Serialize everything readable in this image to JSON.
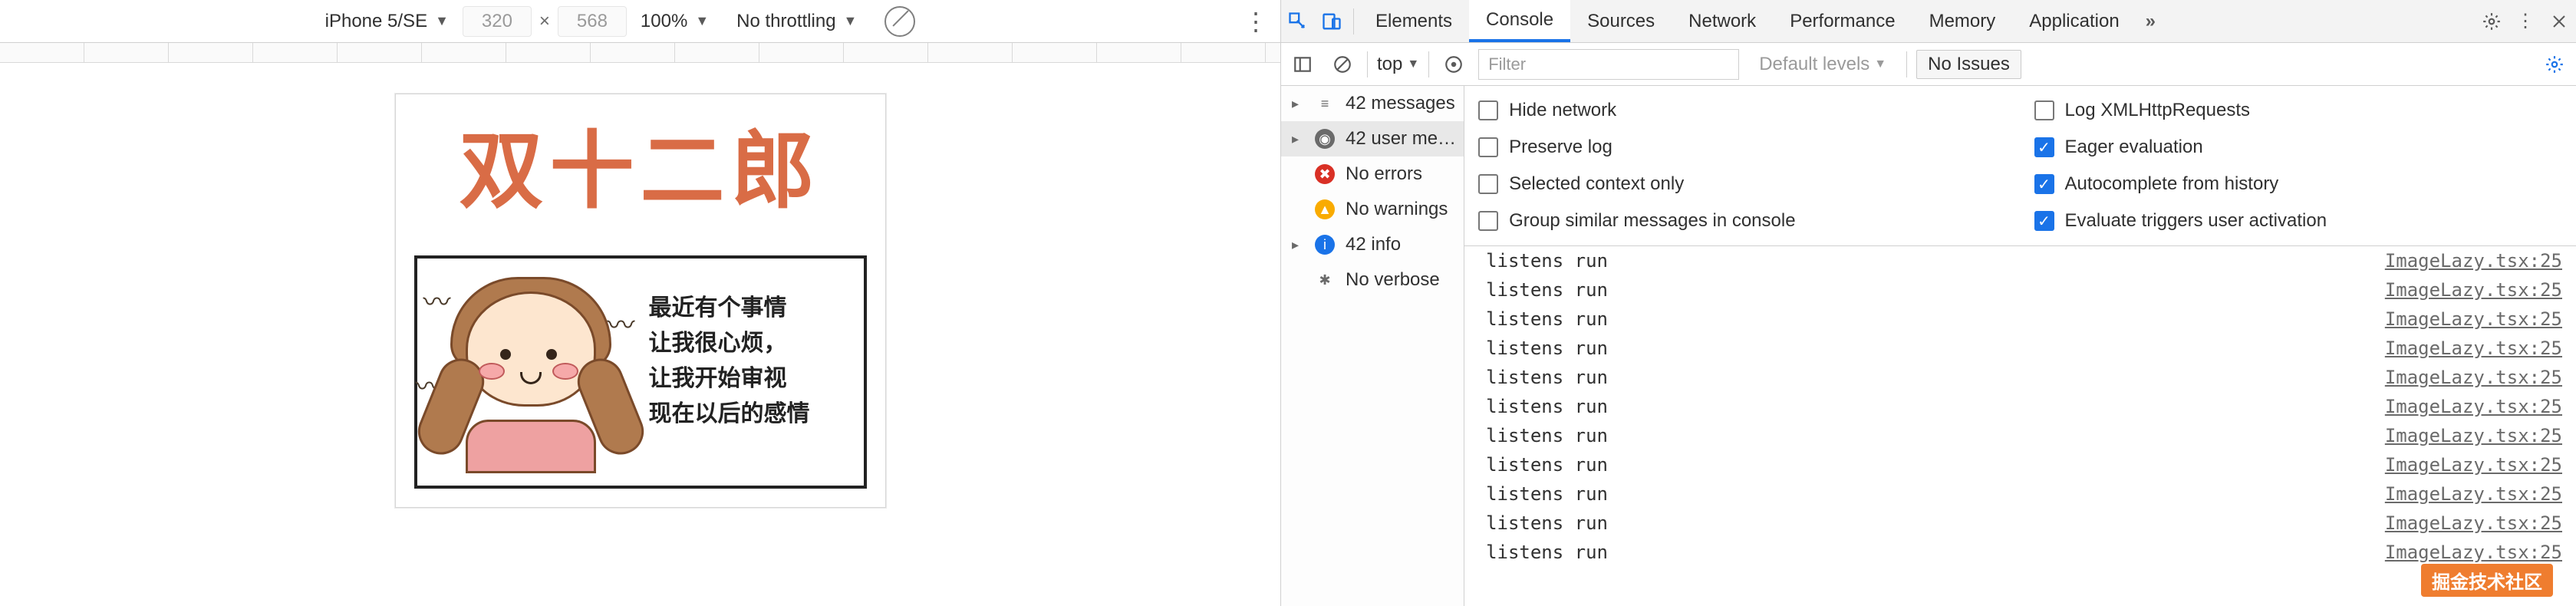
{
  "device_toolbar": {
    "device": "iPhone 5/SE",
    "width": "320",
    "height": "568",
    "zoom": "100%",
    "throttling": "No throttling"
  },
  "phone_content": {
    "headline": "双十二郎",
    "panel_lines": [
      "最近有个事情",
      "让我很心烦，",
      "让我开始审视",
      "现在以后的感情"
    ]
  },
  "devtools": {
    "tabs": [
      "Elements",
      "Console",
      "Sources",
      "Network",
      "Performance",
      "Memory",
      "Application"
    ],
    "active_tab": "Console",
    "more": "»"
  },
  "filterbar": {
    "context": "top",
    "filter_placeholder": "Filter",
    "levels": "Default levels",
    "issues": "No Issues"
  },
  "sidebar": [
    {
      "caret": true,
      "icon": "msg",
      "label": "42 messages"
    },
    {
      "caret": true,
      "icon": "user",
      "label": "42 user me…",
      "selected": true
    },
    {
      "caret": false,
      "icon": "err",
      "label": "No errors"
    },
    {
      "caret": false,
      "icon": "warn",
      "label": "No warnings"
    },
    {
      "caret": true,
      "icon": "info",
      "label": "42 info"
    },
    {
      "caret": false,
      "icon": "verb",
      "label": "No verbose"
    }
  ],
  "settings": {
    "left": [
      {
        "label": "Hide network",
        "checked": false
      },
      {
        "label": "Preserve log",
        "checked": false
      },
      {
        "label": "Selected context only",
        "checked": false
      },
      {
        "label": "Group similar messages in console",
        "checked": false
      }
    ],
    "right": [
      {
        "label": "Log XMLHttpRequests",
        "checked": false
      },
      {
        "label": "Eager evaluation",
        "checked": true
      },
      {
        "label": "Autocomplete from history",
        "checked": true
      },
      {
        "label": "Evaluate triggers user activation",
        "checked": true
      }
    ]
  },
  "log_message": "listens run",
  "log_source": "ImageLazy.tsx:25",
  "log_count": 11,
  "watermark": "掘金技术社区"
}
